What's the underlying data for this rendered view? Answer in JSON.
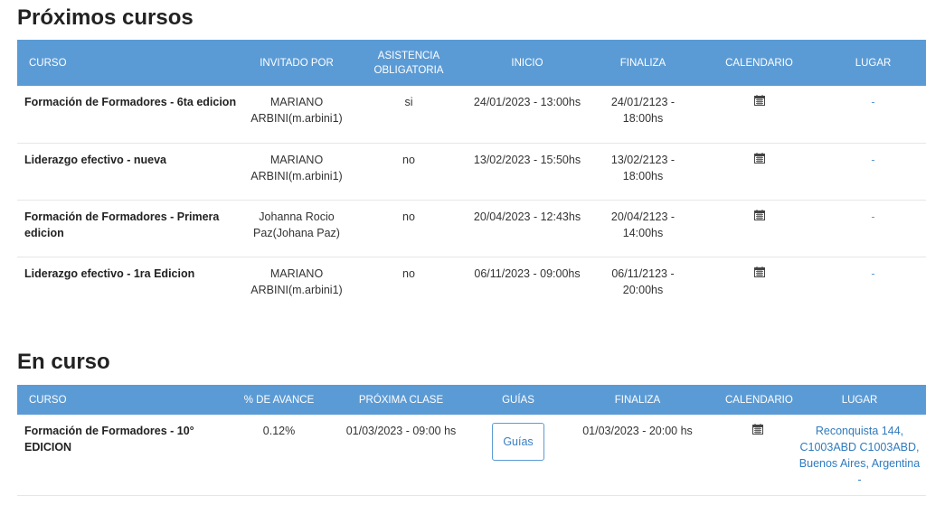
{
  "upcoming": {
    "title": "Próximos cursos",
    "headers": [
      "CURSO",
      "INVITADO POR",
      "ASISTENCIA OBLIGATORIA",
      "INICIO",
      "FINALIZA",
      "CALENDARIO",
      "LUGAR"
    ],
    "rows": [
      {
        "course": "Formación de Formadores - 6ta edicion",
        "invited": "MARIANO ARBINI(m.arbini1)",
        "mandatory": "si",
        "start": "24/01/2023 - 13:00hs",
        "end": "24/01/2123 - 18:00hs",
        "calendar_icon": "calendar-icon",
        "place": "-"
      },
      {
        "course": "Liderazgo efectivo - nueva",
        "invited": "MARIANO ARBINI(m.arbini1)",
        "mandatory": "no",
        "start": "13/02/2023 - 15:50hs",
        "end": "13/02/2123 - 18:00hs",
        "calendar_icon": "calendar-icon",
        "place": "-"
      },
      {
        "course": "Formación de Formadores - Primera edicion",
        "invited": "Johanna Rocio Paz(Johana Paz)",
        "mandatory": "no",
        "start": "20/04/2023 - 12:43hs",
        "end": "20/04/2123 - 14:00hs",
        "calendar_icon": "calendar-icon",
        "place": "-"
      },
      {
        "course": "Liderazgo efectivo - 1ra Edicion",
        "invited": "MARIANO ARBINI(m.arbini1)",
        "mandatory": "no",
        "start": "06/11/2023 - 09:00hs",
        "end": "06/11/2123 - 20:00hs",
        "calendar_icon": "calendar-icon",
        "place": "-"
      }
    ]
  },
  "current": {
    "title": "En curso",
    "headers": [
      "CURSO",
      "% DE AVANCE",
      "PRÓXIMA CLASE",
      "GUÍAS",
      "FINALIZA",
      "CALENDARIO",
      "LUGAR"
    ],
    "rows": [
      {
        "course": "Formación de Formadores - 10° EDICION",
        "progress": "0.12%",
        "next_class": "01/03/2023 - 09:00 hs",
        "guides_label": "Guías",
        "end": "01/03/2023 - 20:00 hs",
        "calendar_icon": "calendar-icon",
        "place": "Reconquista 144, C1003ABD C1003ABD, Buenos Aires, Argentina -"
      }
    ]
  },
  "colors": {
    "header_bg": "#5b9bd5",
    "link": "#2f7bbf"
  }
}
